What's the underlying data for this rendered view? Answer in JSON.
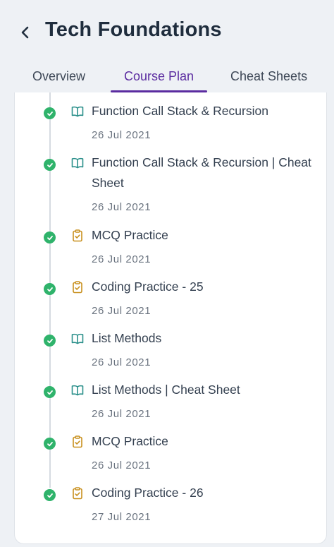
{
  "header": {
    "title": "Tech Foundations",
    "back_icon": "chevron-left-icon"
  },
  "tabs": [
    {
      "label": "Overview",
      "active": false
    },
    {
      "label": "Course Plan",
      "active": true
    },
    {
      "label": "Cheat Sheets",
      "active": false
    }
  ],
  "colors": {
    "accent": "#5b2ca0",
    "completed": "#2fb36b",
    "reading_icon": "#2a8f8a",
    "practice_icon": "#c8901e"
  },
  "items": [
    {
      "title": "Function Call Stack & Recursion",
      "date": "26 Jul 2021",
      "type": "reading",
      "icon": "book-icon",
      "status": "completed"
    },
    {
      "title": "Function Call Stack & Recursion | Cheat Sheet",
      "date": "26 Jul 2021",
      "type": "reading",
      "icon": "book-icon",
      "status": "completed"
    },
    {
      "title": "MCQ Practice",
      "date": "26 Jul 2021",
      "type": "practice",
      "icon": "clipboard-check-icon",
      "status": "completed"
    },
    {
      "title": "Coding Practice - 25",
      "date": "26 Jul 2021",
      "type": "practice",
      "icon": "clipboard-check-icon",
      "status": "completed"
    },
    {
      "title": "List Methods",
      "date": "26 Jul 2021",
      "type": "reading",
      "icon": "book-icon",
      "status": "completed"
    },
    {
      "title": "List Methods | Cheat Sheet",
      "date": "26 Jul 2021",
      "type": "reading",
      "icon": "book-icon",
      "status": "completed"
    },
    {
      "title": "MCQ Practice",
      "date": "26 Jul 2021",
      "type": "practice",
      "icon": "clipboard-check-icon",
      "status": "completed"
    },
    {
      "title": "Coding Practice - 26",
      "date": "27 Jul 2021",
      "type": "practice",
      "icon": "clipboard-check-icon",
      "status": "completed"
    }
  ]
}
